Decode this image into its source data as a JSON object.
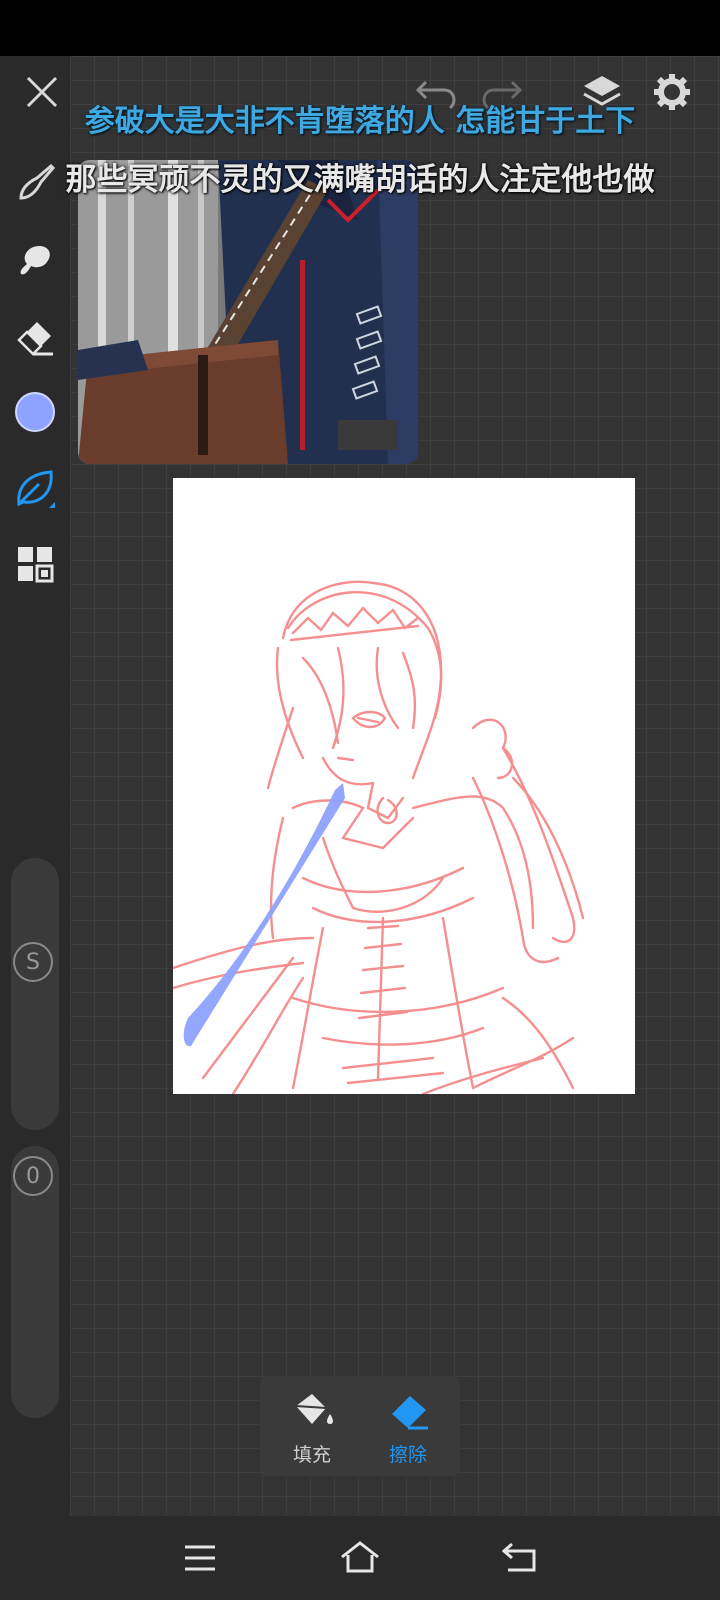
{
  "lyrics": {
    "line1": "参破大是大非不肯堕落的人 怎能甘于土下",
    "line2": "那些冥顽不灵的又满嘴胡话的人注定他也做"
  },
  "colors": {
    "brush": "#8ea2ff",
    "accent": "#2196f3",
    "sketch": "#f58a8a",
    "panel_label": "#cfcfcf"
  },
  "toolbar": {
    "close": "close-icon",
    "undo": "undo-icon",
    "redo": "redo-icon",
    "layers": "layers-icon",
    "settings": "gear-icon"
  },
  "left_tools": [
    "brush-icon",
    "smudge-icon",
    "eraser-icon",
    "color-swatch",
    "leaf-brush-icon",
    "grid-icon"
  ],
  "sliders": {
    "size_label": "S",
    "opacity_label": "0"
  },
  "bottom_panel": {
    "fill_label": "填充",
    "erase_label": "擦除",
    "active": "erase"
  },
  "navbar": [
    "menu-icon",
    "home-icon",
    "back-icon"
  ]
}
